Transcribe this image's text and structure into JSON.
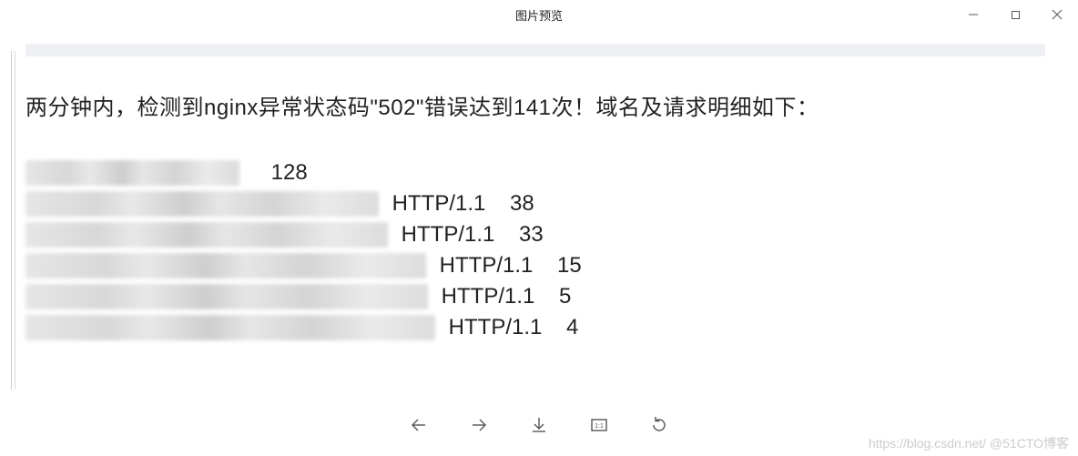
{
  "window": {
    "title": "图片预览"
  },
  "content": {
    "message": "两分钟内，检测到nginx异常状态码\"502\"错误达到141次！域名及请求明细如下：",
    "rows": [
      {
        "blur_width": 235,
        "protocol": "",
        "count": "128"
      },
      {
        "blur_width": 388,
        "protocol": "HTTP/1.1",
        "count": "38"
      },
      {
        "blur_width": 398,
        "protocol": "HTTP/1.1",
        "count": "33"
      },
      {
        "blur_width": 440,
        "protocol": "HTTP/1.1",
        "count": "15"
      },
      {
        "blur_width": 442,
        "protocol": "HTTP/1.1",
        "count": "5"
      },
      {
        "blur_width": 450,
        "protocol": "HTTP/1.1",
        "count": "4"
      }
    ]
  },
  "toolbar": {
    "prev": "上一张",
    "next": "下一张",
    "download": "下载",
    "original_size": "原始尺寸",
    "rotate": "旋转"
  },
  "watermark": "https://blog.csdn.net/  @51CTO博客"
}
